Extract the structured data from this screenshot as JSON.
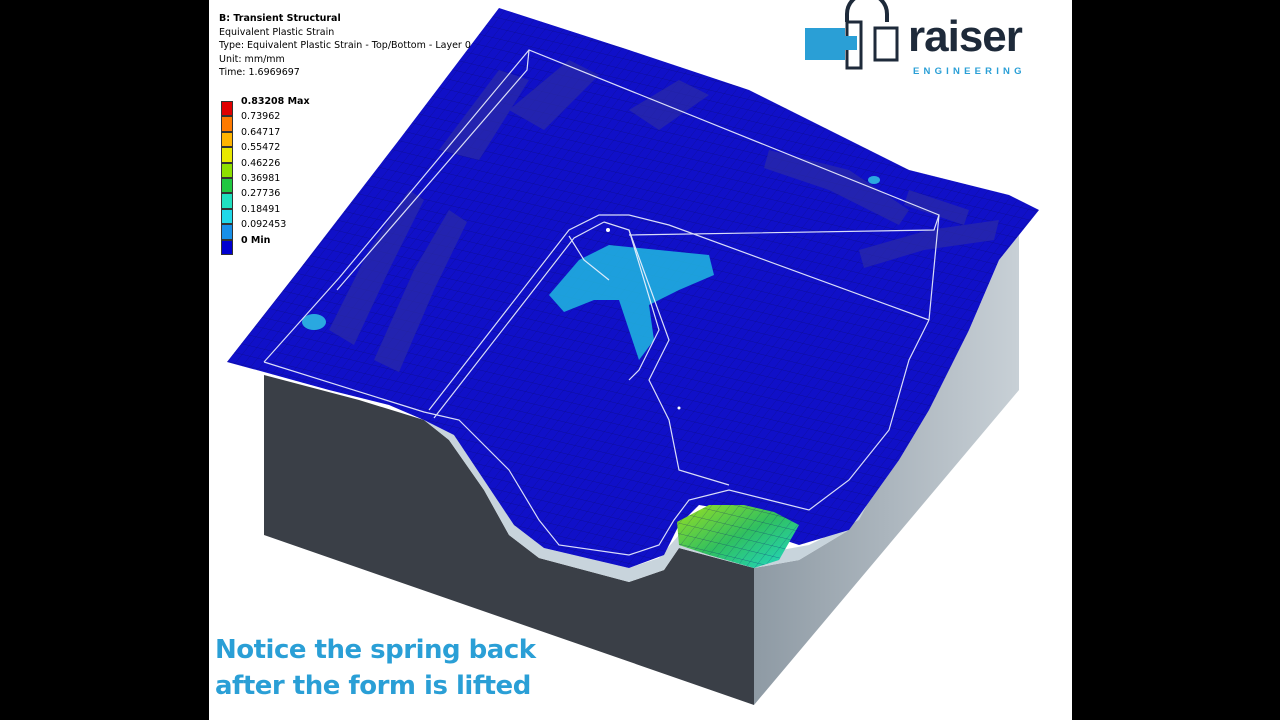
{
  "info": {
    "analysis": "B: Transient Structural",
    "result": "Equivalent Plastic Strain",
    "type": "Type: Equivalent Plastic Strain - Top/Bottom - Layer 0",
    "unit": "Unit: mm/mm",
    "time": "Time: 1.6969697"
  },
  "legend": [
    {
      "label": "0.83208 Max",
      "color": "#e00000",
      "bold": true
    },
    {
      "label": "0.73962",
      "color": "#ff7a00",
      "bold": false
    },
    {
      "label": "0.64717",
      "color": "#ffb400",
      "bold": false
    },
    {
      "label": "0.55472",
      "color": "#e8e800",
      "bold": false
    },
    {
      "label": "0.46226",
      "color": "#8ee000",
      "bold": false
    },
    {
      "label": "0.36981",
      "color": "#20c840",
      "bold": false
    },
    {
      "label": "0.27736",
      "color": "#20e0c0",
      "bold": false
    },
    {
      "label": "0.18491",
      "color": "#20d8e8",
      "bold": false
    },
    {
      "label": "0.092453",
      "color": "#1890e8",
      "bold": false
    },
    {
      "label": "0 Min",
      "color": "#0000d0",
      "bold": true
    }
  ],
  "logo": {
    "word": "raiser",
    "sub": "ENGINEERING",
    "colors": {
      "accent": "#2a9fd6",
      "dark": "#1e2a3a"
    }
  },
  "caption": {
    "line1": "Notice the spring back",
    "line2": "after the form is lifted"
  },
  "colors": {
    "sheet": "#1010c8",
    "die_front": "#3a3f47",
    "die_side": "#b9c4cc"
  }
}
